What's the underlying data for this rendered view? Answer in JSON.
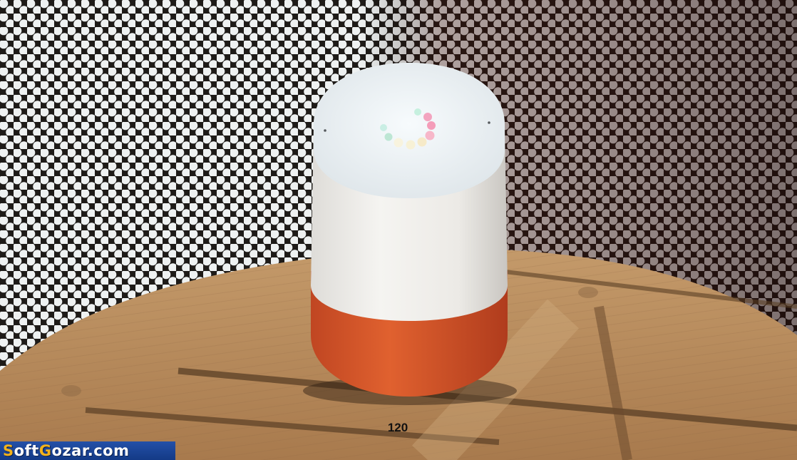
{
  "photo": {
    "subject": "smart-speaker-on-wooden-stool",
    "colors": {
      "mesh_light": "#e9ecec",
      "mesh_dark": "#1d1a18",
      "wood": "#b88a5c",
      "speaker_top": "#e8eef1",
      "speaker_body": "#f3f2ef",
      "fabric_base": "#d4562b",
      "led_colors": [
        "#f3a4bf",
        "#f49db9",
        "#f6eac8",
        "#f7f1d6",
        "#bde6d4",
        "#c6f0df"
      ]
    }
  },
  "page_number": "120",
  "watermark": {
    "text": "SoftGozar.com",
    "accent_letters": "S G",
    "background": "#1e4aa0",
    "accent_color": "#f2b21c"
  }
}
